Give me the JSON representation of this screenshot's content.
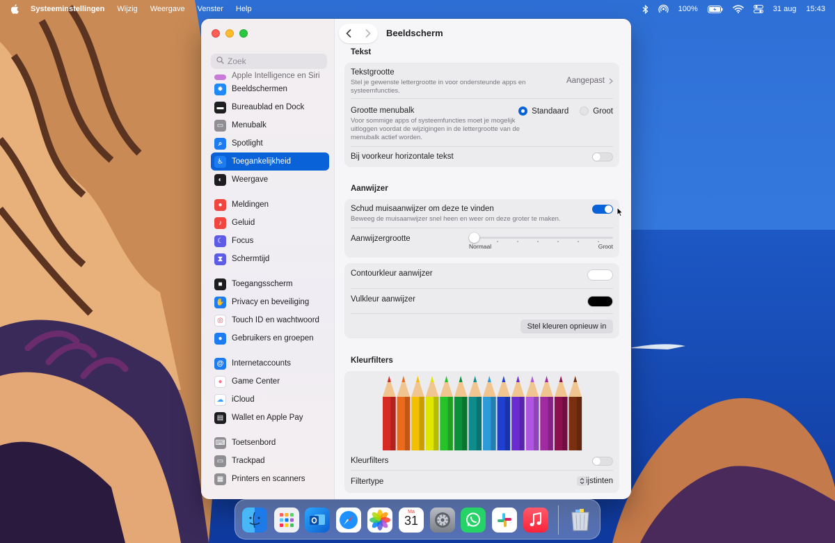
{
  "menubar": {
    "app_name": "Systeeminstellingen",
    "menus": [
      "Wijzig",
      "Weergave",
      "Venster",
      "Help"
    ],
    "battery": "100%",
    "date": "31 aug",
    "time": "15:43"
  },
  "window": {
    "title": "Beeldscherm",
    "search_placeholder": "Zoek"
  },
  "sidebar": {
    "clipped_item": "Apple Intelligence en Siri",
    "items": [
      {
        "label": "Beeldschermen",
        "icon": "sun-icon",
        "color": "#1f8af7"
      },
      {
        "label": "Bureaublad en Dock",
        "icon": "dock-icon",
        "color": "#1f1f1f"
      },
      {
        "label": "Menubalk",
        "icon": "menubar-icon",
        "color": "#8e8e93"
      },
      {
        "label": "Spotlight",
        "icon": "magnifier-icon",
        "color": "#1e7cf2"
      },
      {
        "label": "Toegankelijkheid",
        "icon": "accessibility-icon",
        "color": "#1e7cf2",
        "active": true
      },
      {
        "label": "Weergave",
        "icon": "appearance-icon",
        "color": "#1d1d1f"
      },
      {
        "label": "Meldingen",
        "icon": "bell-icon",
        "color": "#f0463f"
      },
      {
        "label": "Geluid",
        "icon": "speaker-icon",
        "color": "#f0463f"
      },
      {
        "label": "Focus",
        "icon": "moon-icon",
        "color": "#5e5ce6"
      },
      {
        "label": "Schermtijd",
        "icon": "hourglass-icon",
        "color": "#5e5ce6"
      },
      {
        "label": "Toegangsscherm",
        "icon": "lock-icon",
        "color": "#1d1d1f"
      },
      {
        "label": "Privacy en beveiliging",
        "icon": "hand-icon",
        "color": "#1e7cf2"
      },
      {
        "label": "Touch ID en wachtwoord",
        "icon": "fingerprint-icon",
        "color": "#ffffff"
      },
      {
        "label": "Gebruikers en groepen",
        "icon": "users-icon",
        "color": "#1e7cf2"
      },
      {
        "label": "Internetaccounts",
        "icon": "at-icon",
        "color": "#1e7cf2"
      },
      {
        "label": "Game Center",
        "icon": "gamecenter-icon",
        "color": "#ffffff"
      },
      {
        "label": "iCloud",
        "icon": "cloud-icon",
        "color": "#ffffff"
      },
      {
        "label": "Wallet en Apple Pay",
        "icon": "wallet-icon",
        "color": "#1d1d1f"
      },
      {
        "label": "Toetsenbord",
        "icon": "keyboard-icon",
        "color": "#8e8e93"
      },
      {
        "label": "Trackpad",
        "icon": "trackpad-icon",
        "color": "#8e8e93"
      },
      {
        "label": "Printers en scanners",
        "icon": "printer-icon",
        "color": "#8e8e93"
      }
    ]
  },
  "content": {
    "tekst": {
      "title": "Tekst",
      "tekstgrootte_label": "Tekstgrootte",
      "tekstgrootte_sub": "Stel je gewenste lettergrootte in voor ondersteunde apps en systeemfuncties.",
      "tekstgrootte_value": "Aangepast",
      "menubalk_label": "Grootte menubalk",
      "menubalk_sub": "Voor sommige apps of systeemfuncties moet je mogelijk uitloggen voordat de wijzigingen in de lettergrootte van de menubalk actief worden.",
      "radio_standaard": "Standaard",
      "radio_groot": "Groot",
      "radio_selected": "Standaard",
      "horizontaal_label": "Bij voorkeur horizontale tekst",
      "horizontaal_on": false
    },
    "aanwijzer": {
      "title": "Aanwijzer",
      "schud_label": "Schud muisaanwijzer om deze te vinden",
      "schud_sub": "Beweeg de muisaanwijzer snel heen en weer om deze groter te maken.",
      "schud_on": true,
      "grootte_label": "Aanwijzergrootte",
      "grootte_min": "Normaal",
      "grootte_max": "Groot",
      "grootte_value": 0,
      "contour_label": "Contourkleur aanwijzer",
      "contour_color": "#ffffff",
      "vul_label": "Vulkleur aanwijzer",
      "vul_color": "#000000",
      "reset_button": "Stel kleuren opnieuw in"
    },
    "kleurfilters": {
      "title": "Kleurfilters",
      "pencil_colors": [
        "#d62a24",
        "#ec6a1c",
        "#f3c000",
        "#dfe600",
        "#25c22a",
        "#0c8f3a",
        "#0e8c8c",
        "#2d9bd8",
        "#1f3fd0",
        "#6a2cd0",
        "#b055e0",
        "#a02aa0",
        "#8c1050",
        "#7a3010"
      ],
      "filters_label": "Kleurfilters",
      "filters_on": false,
      "filtertype_label": "Filtertype",
      "filtertype_value": "Grijstinten"
    }
  },
  "dock": {
    "calendar_month": "Ma",
    "calendar_day": "31",
    "apps": [
      "finder-icon",
      "launchpad-icon",
      "outlook-icon",
      "safari-icon",
      "photos-icon",
      "calendar-icon",
      "system-settings-icon",
      "whatsapp-icon",
      "slack-icon",
      "music-icon",
      "trash-icon"
    ]
  }
}
